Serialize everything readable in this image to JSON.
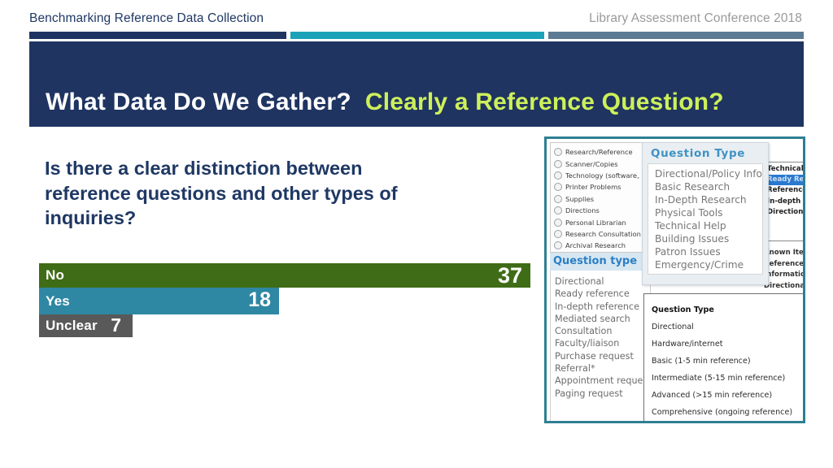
{
  "header": {
    "left_title": "Benchmarking Reference Data Collection",
    "right_title": "Library Assessment Conference 2018",
    "rule_colors": {
      "navy": "#1f3461",
      "teal": "#1ba2b8",
      "steel": "#5b7b94"
    }
  },
  "title_banner": {
    "main": "What Data Do We Gather?",
    "accent": "Clearly a Reference Question?",
    "background": "#1f3461",
    "main_color": "#ffffff",
    "accent_color": "#cdf05a"
  },
  "body": {
    "question": "Is there a clear distinction between reference questions and other types of inquiries?",
    "question_color": "#1f3864"
  },
  "chart_data": {
    "type": "bar",
    "orientation": "horizontal",
    "title": "",
    "xlabel": "",
    "ylabel": "",
    "categories": [
      "No",
      "Yes",
      "Unclear"
    ],
    "values": [
      37,
      18,
      7
    ],
    "value_labels": [
      "37",
      "18",
      "7"
    ],
    "colors": [
      "#3f6c16",
      "#2e87a3",
      "#595959"
    ],
    "label_color": "#ffffff",
    "grid": false,
    "legend": "none",
    "xlim": [
      0,
      37
    ]
  },
  "screenshot_collage": {
    "border_color": "#2e7f92",
    "radio_panel": {
      "options": [
        "Research/Reference",
        "Scanner/Copies",
        "Technology (software,",
        "Printer Problems",
        "Supplies",
        "Directions",
        "Personal Librarian",
        "Research Consultation",
        "Archival Research"
      ]
    },
    "question_type_box": {
      "heading": "Question type",
      "items": [
        "Directional",
        "Ready reference",
        "In-depth reference",
        "Mediated search",
        "Consultation",
        "Faculty/liaison",
        "Purchase request",
        "Referral*",
        "Appointment request",
        "Paging request"
      ]
    },
    "dropdown_panel": {
      "heading": "Question Type",
      "items": [
        "Directional/Policy Info",
        "Basic Research",
        "In-Depth Research",
        "Physical Tools",
        "Technical Help",
        "Building Issues",
        "Patron Issues",
        "Emergency/Crime"
      ]
    },
    "select_panel": {
      "items": [
        "Technical",
        "Ready Ref",
        "Reference",
        "In-depth",
        "Directional"
      ],
      "selected": "Ready Ref",
      "selected_color": "#2a79d0"
    },
    "fragment_panel": {
      "items": [
        "Known Item",
        "Reference",
        "Information",
        "Directional"
      ]
    },
    "detail_panel": {
      "title": "Question Type",
      "items": [
        "Directional",
        "Hardware/internet",
        "Basic (1-5 min reference)",
        "Intermediate (5-15 min reference)",
        "Advanced (>15 min  reference)",
        "Comprehensive (ongoing reference)"
      ]
    }
  }
}
